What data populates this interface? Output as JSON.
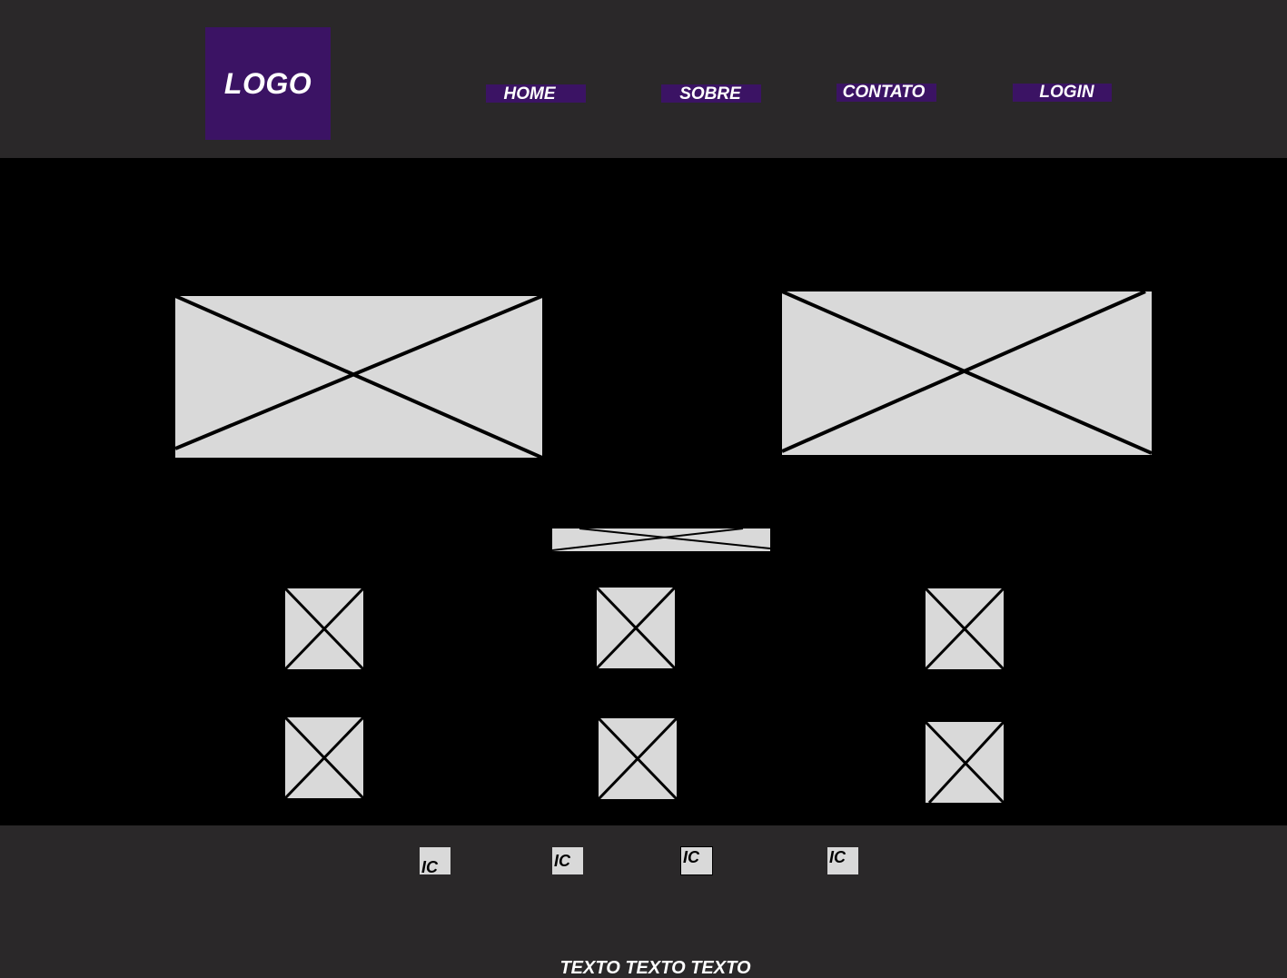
{
  "header": {
    "logo": "LOGO",
    "nav": [
      {
        "label": "HOME"
      },
      {
        "label": "SOBRE"
      },
      {
        "label": "CONTATO"
      },
      {
        "label": "LOGIN"
      }
    ]
  },
  "footer": {
    "icons": [
      {
        "label": "IC"
      },
      {
        "label": "IC"
      },
      {
        "label": "IC"
      },
      {
        "label": "IC"
      }
    ],
    "text": "TEXTO TEXTO TEXTO"
  },
  "colors": {
    "header_bg": "#2a2829",
    "accent": "#3b1364",
    "main_bg": "#000000",
    "placeholder": "#d9d9d9"
  }
}
